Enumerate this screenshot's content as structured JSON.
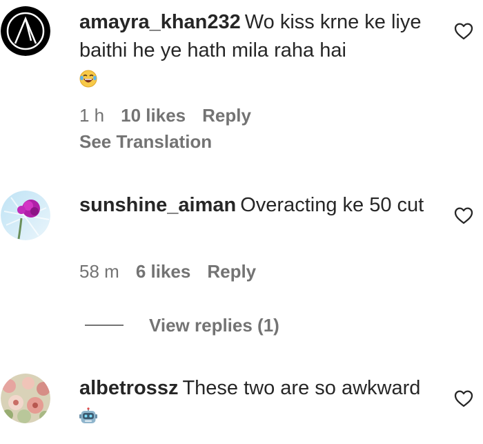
{
  "comments": [
    {
      "username": "amayra_khan232",
      "text": "Wo kiss krne ke liye baithi he ye hath mila raha hai",
      "emoji": "laughing-tears-emoji",
      "time": "1 h",
      "likes": "10 likes",
      "reply_label": "Reply",
      "see_translation": "See Translation",
      "avatar": "circular-logo-avatar"
    },
    {
      "username": "sunshine_aiman",
      "text": "Overacting ke 50 cut",
      "time": "58 m",
      "likes": "6 likes",
      "reply_label": "Reply",
      "view_replies": "View replies (1)",
      "avatar": "flower-avatar"
    },
    {
      "username": "albetrossz",
      "text": "These two are so awkward",
      "emoji": "robot-emoji",
      "avatar": "flowers-avatar"
    }
  ],
  "colors": {
    "text": "#262626",
    "secondary": "#737373"
  }
}
